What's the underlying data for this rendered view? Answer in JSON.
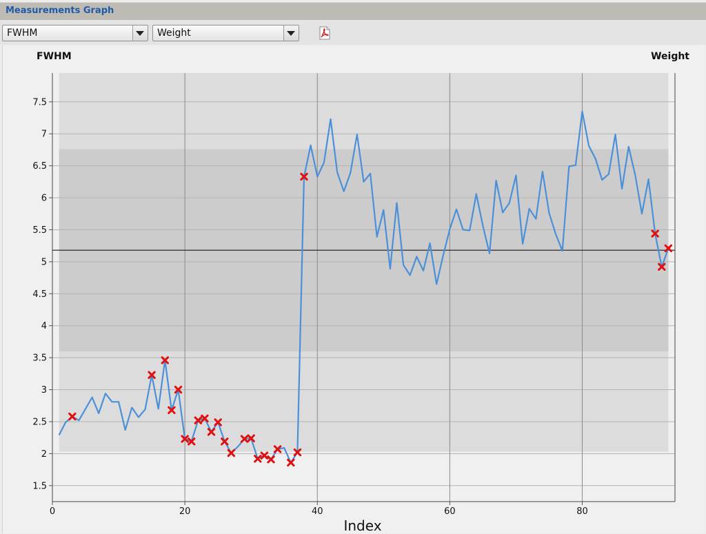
{
  "window": {
    "title": "Measurements Graph"
  },
  "toolbar": {
    "left_combo_value": "FWHM",
    "right_combo_value": "Weight",
    "pdf_icon": "pdf-export-icon"
  },
  "colors": {
    "line": "#4a90d9",
    "marker": "#e01010",
    "band_outer": "#dcdcdc",
    "band_inner": "#cccccc",
    "mean_line": "#000000"
  },
  "chart_data": {
    "type": "line",
    "left_axis_title": "FWHM",
    "right_axis_title": "Weight",
    "xlabel": "Index",
    "xlim": [
      0,
      94
    ],
    "ylim": [
      1.25,
      7.95
    ],
    "xticks": [
      0,
      20,
      40,
      60,
      80
    ],
    "yticks": [
      1.5,
      2,
      2.5,
      3,
      3.5,
      4,
      4.5,
      5,
      5.5,
      6,
      6.5,
      7,
      7.5
    ],
    "ytick_labels": [
      "1.5",
      "2",
      "2.5",
      "3",
      "3.5",
      "4",
      "4.5",
      "5",
      "5.5",
      "6",
      "6.5",
      "7",
      "7.5"
    ],
    "outer_band": {
      "x": [
        1,
        93
      ],
      "y": [
        2.03,
        7.95
      ]
    },
    "inner_band": {
      "x": [
        1,
        93
      ],
      "y": [
        3.6,
        6.76
      ]
    },
    "mean": 5.18,
    "series": [
      {
        "x": [
          1,
          2,
          3,
          4,
          5,
          6,
          7,
          8,
          9,
          10,
          11,
          12,
          13,
          14,
          15,
          16,
          17,
          18,
          19,
          20,
          21,
          22,
          23,
          24,
          25,
          26,
          27,
          28,
          29,
          30,
          31,
          32,
          33,
          34,
          35,
          36,
          37,
          38,
          39,
          40,
          41,
          42,
          43,
          44,
          45,
          46,
          47,
          48,
          49,
          50,
          51,
          52,
          53,
          54,
          55,
          56,
          57,
          58,
          59,
          60,
          61,
          62,
          63,
          64,
          65,
          66,
          67,
          68,
          69,
          70,
          71,
          72,
          73,
          74,
          75,
          76,
          77,
          78,
          79,
          80,
          81,
          82,
          83,
          84,
          85,
          86,
          87,
          88,
          89,
          90,
          91,
          92,
          93
        ],
        "y": [
          2.29,
          2.49,
          2.58,
          2.52,
          2.7,
          2.88,
          2.63,
          2.94,
          2.81,
          2.81,
          2.37,
          2.72,
          2.57,
          2.69,
          3.23,
          2.7,
          3.46,
          2.68,
          3.0,
          2.23,
          2.19,
          2.52,
          2.55,
          2.34,
          2.49,
          2.19,
          2.01,
          2.11,
          2.23,
          2.24,
          1.92,
          1.97,
          1.91,
          2.07,
          2.09,
          1.86,
          2.02,
          6.33,
          6.82,
          6.33,
          6.55,
          7.23,
          6.4,
          6.1,
          6.39,
          6.99,
          6.25,
          6.38,
          5.39,
          5.81,
          4.89,
          5.92,
          4.95,
          4.79,
          5.08,
          4.86,
          5.29,
          4.65,
          5.1,
          5.51,
          5.82,
          5.5,
          5.49,
          6.06,
          5.56,
          5.13,
          6.27,
          5.77,
          5.92,
          6.35,
          5.28,
          5.83,
          5.67,
          6.41,
          5.76,
          5.43,
          5.17,
          6.49,
          6.51,
          7.35,
          6.81,
          6.61,
          6.28,
          6.37,
          6.99,
          6.14,
          6.8,
          6.35,
          5.75,
          6.29,
          5.44,
          4.92,
          5.21
        ]
      }
    ],
    "flagged_x": [
      3,
      15,
      17,
      18,
      19,
      20,
      21,
      22,
      23,
      24,
      25,
      26,
      27,
      29,
      30,
      31,
      32,
      33,
      34,
      36,
      37,
      38,
      91,
      92,
      93
    ]
  }
}
